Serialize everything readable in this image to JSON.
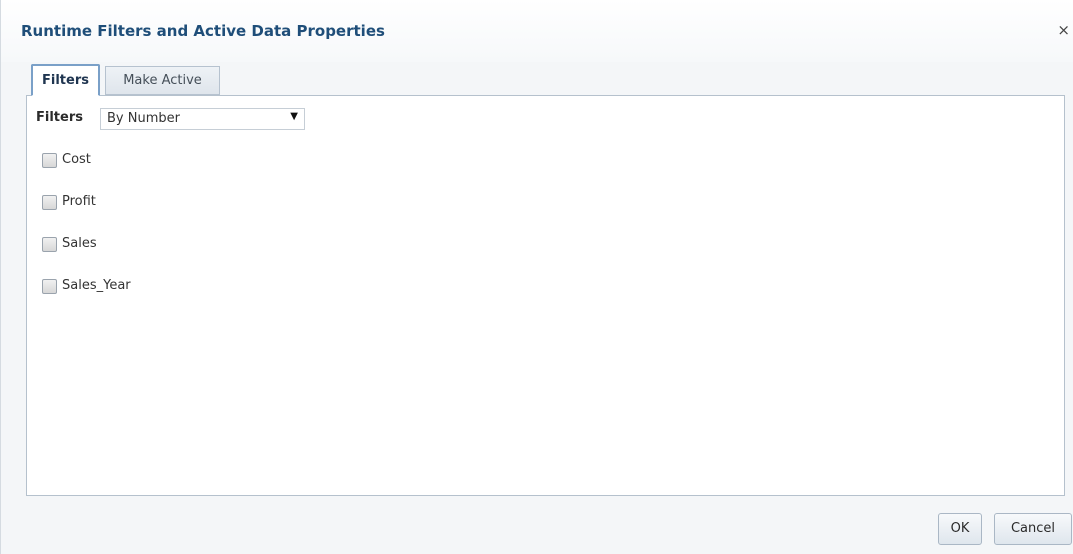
{
  "dialog": {
    "title": "Runtime Filters and Active Data Properties",
    "close_glyph": "×"
  },
  "tabs": [
    {
      "label": "Filters",
      "selected": true
    },
    {
      "label": "Make Active",
      "selected": false
    }
  ],
  "filters": {
    "label": "Filters",
    "select": {
      "value": "By Number",
      "arrow_glyph": "▼"
    },
    "items": [
      {
        "label": "Cost",
        "checked": false
      },
      {
        "label": "Profit",
        "checked": false
      },
      {
        "label": "Sales",
        "checked": false
      },
      {
        "label": "Sales_Year",
        "checked": false
      }
    ]
  },
  "buttons": {
    "ok_label": "OK",
    "cancel_label": "Cancel"
  },
  "colors": {
    "title": "#1f4e79",
    "selected_tab_border": "#7aa0c8"
  },
  "icons": {
    "close": "close-icon",
    "dropdown": "chevron-down-icon",
    "checkbox": "checkbox-icon"
  }
}
